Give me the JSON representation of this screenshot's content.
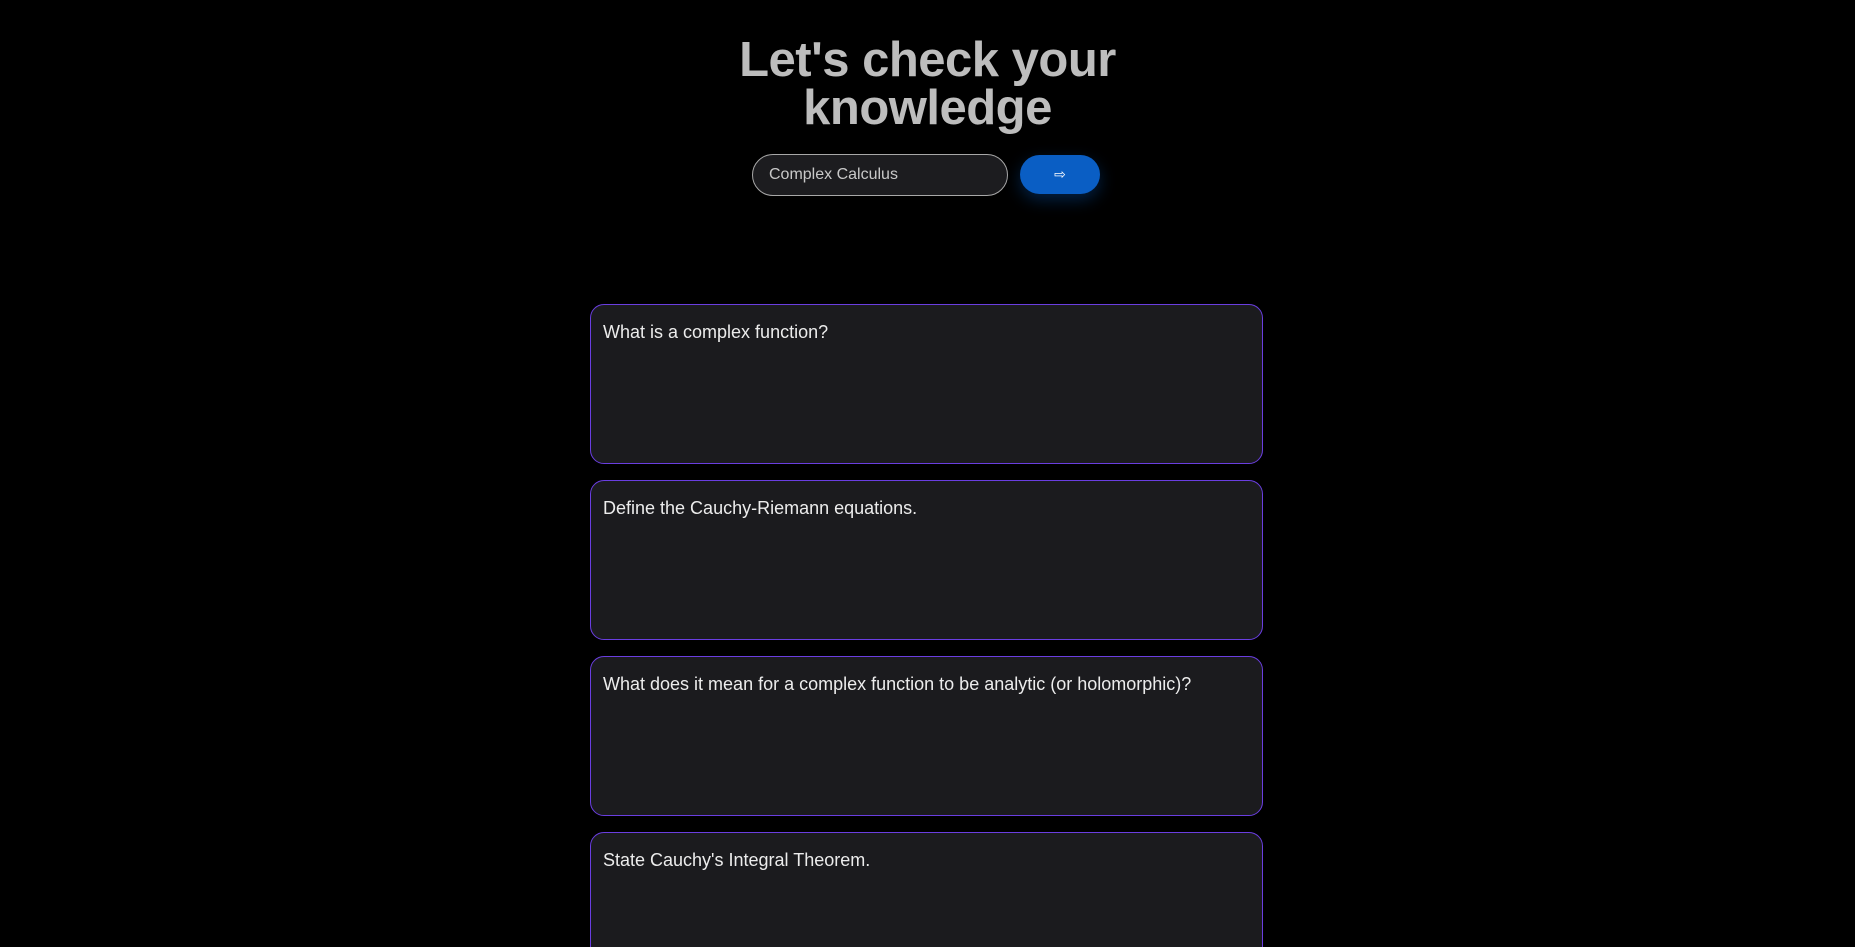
{
  "header": {
    "title_line1": "Let's check your",
    "title_line2": "knowledge"
  },
  "search": {
    "value": "Complex Calculus"
  },
  "submit": {
    "icon": "arrow-right-icon",
    "glyph": "⇨"
  },
  "colors": {
    "background": "#000000",
    "card_border": "#6a3ee0",
    "button": "#0a5ec4"
  },
  "questions": [
    {
      "text": "What is a complex function?"
    },
    {
      "text": "Define the Cauchy-Riemann equations."
    },
    {
      "text": "What does it mean for a complex function to be analytic (or holomorphic)?"
    },
    {
      "text": "State Cauchy's Integral Theorem."
    }
  ]
}
